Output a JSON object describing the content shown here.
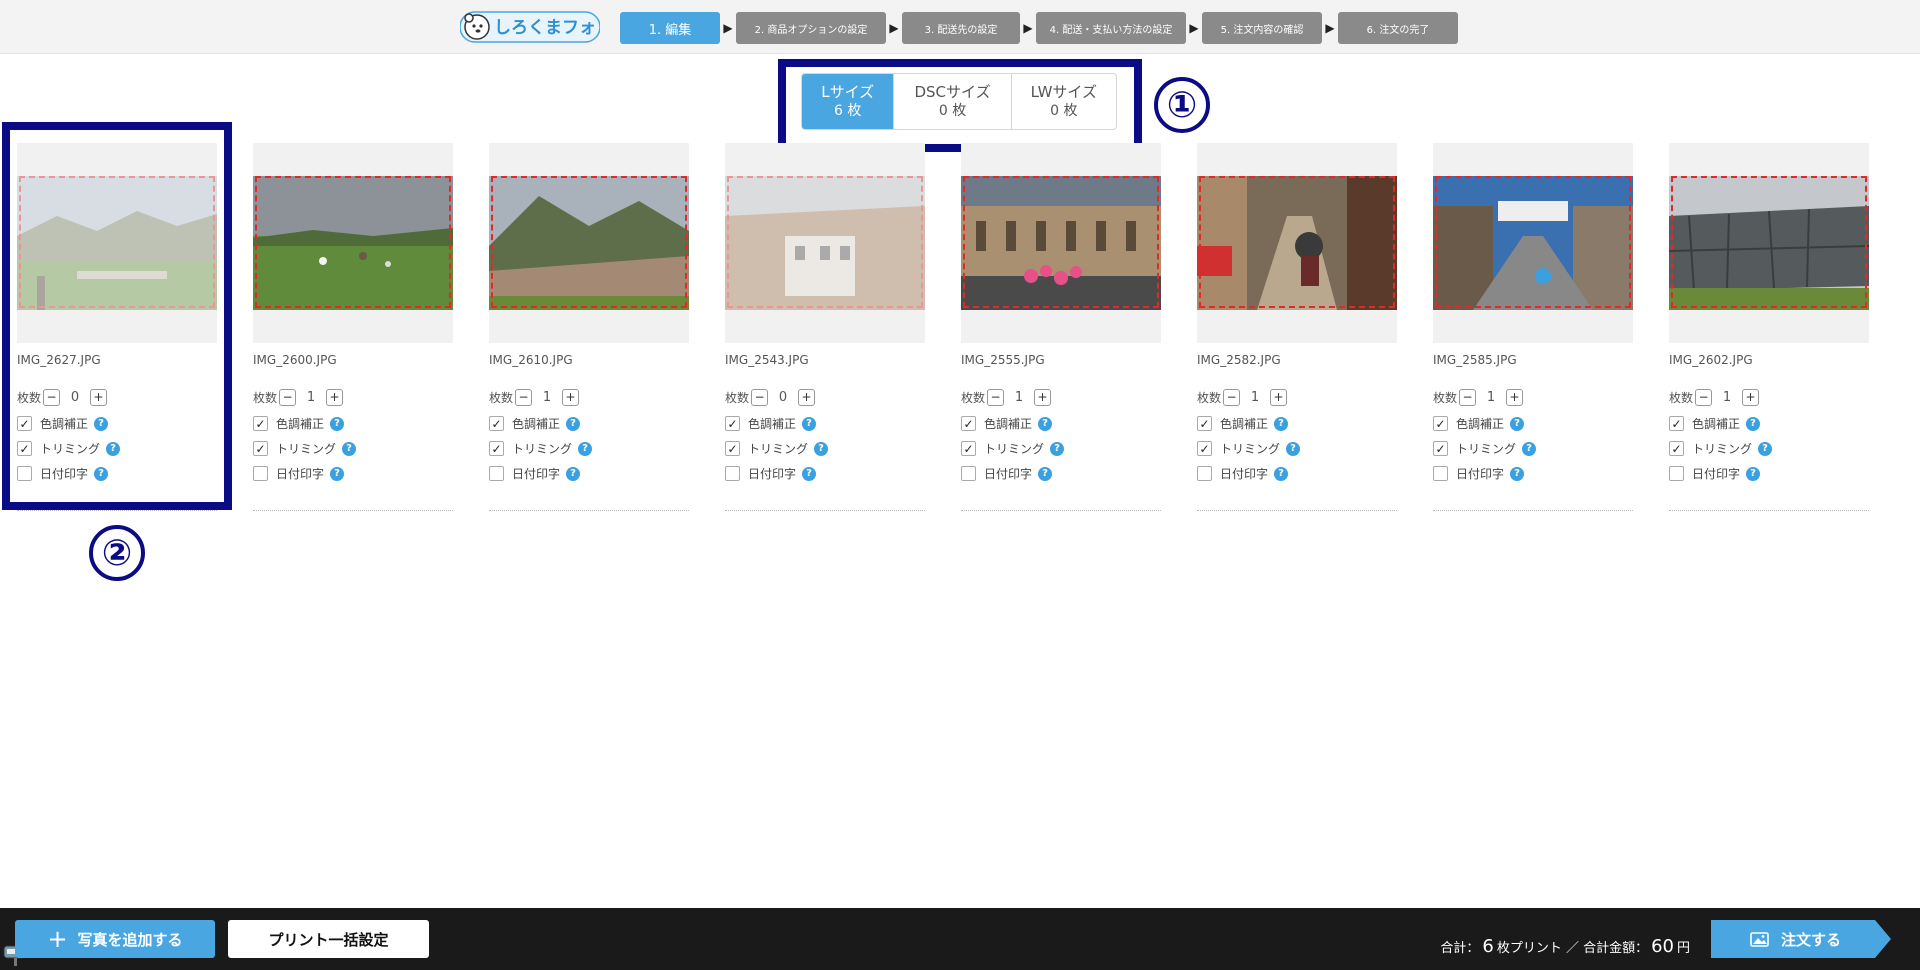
{
  "header": {
    "logo_text": "しろくまフォト",
    "steps": [
      {
        "label": "1. 編集",
        "active": true
      },
      {
        "label": "2. 商品オプションの設定",
        "active": false
      },
      {
        "label": "3. 配送先の設定",
        "active": false
      },
      {
        "label": "4. 配送・支払い方法の設定",
        "active": false
      },
      {
        "label": "5. 注文内容の確認",
        "active": false
      },
      {
        "label": "6. 注文の完了",
        "active": false
      }
    ]
  },
  "size_tabs": [
    {
      "name": "Lサイズ",
      "count": "6 枚",
      "active": true
    },
    {
      "name": "DSCサイズ",
      "count": "0 枚",
      "active": false
    },
    {
      "name": "LWサイズ",
      "count": "0 枚",
      "active": false
    }
  ],
  "annotations": {
    "one": "①",
    "two": "②"
  },
  "labels": {
    "qty": "枚数",
    "color": "色調補正",
    "trim": "トリミング",
    "date": "日付印字",
    "help": "?",
    "minus": "−",
    "plus": "+"
  },
  "photos": [
    {
      "filename": "IMG_2627.JPG",
      "qty": "0",
      "color": true,
      "trim": true,
      "date": false,
      "faded": true,
      "scene": "garden"
    },
    {
      "filename": "IMG_2600.JPG",
      "qty": "1",
      "color": true,
      "trim": true,
      "date": false,
      "faded": false,
      "scene": "meadow"
    },
    {
      "filename": "IMG_2610.JPG",
      "qty": "1",
      "color": true,
      "trim": true,
      "date": false,
      "faded": false,
      "scene": "city-hill"
    },
    {
      "filename": "IMG_2543.JPG",
      "qty": "0",
      "color": true,
      "trim": true,
      "date": false,
      "faded": true,
      "scene": "rooftops"
    },
    {
      "filename": "IMG_2555.JPG",
      "qty": "1",
      "color": true,
      "trim": true,
      "date": false,
      "faded": false,
      "scene": "courtyard"
    },
    {
      "filename": "IMG_2582.JPG",
      "qty": "1",
      "color": true,
      "trim": true,
      "date": false,
      "faded": false,
      "scene": "street"
    },
    {
      "filename": "IMG_2585.JPG",
      "qty": "1",
      "color": true,
      "trim": true,
      "date": false,
      "faded": false,
      "scene": "avenue"
    },
    {
      "filename": "IMG_2602.JPG",
      "qty": "1",
      "color": true,
      "trim": true,
      "date": false,
      "faded": false,
      "scene": "stone-wall"
    }
  ],
  "footer": {
    "add_photo": "写真を追加する",
    "bulk_print": "プリント一括設定",
    "total_prefix": "合計：",
    "total_count": "6",
    "total_mid": "枚プリント ／ 合計金額：",
    "total_amount": "60",
    "total_unit": "円",
    "order": "注文する"
  },
  "colors": {
    "accent": "#4aa6e0",
    "annotation": "#0b0b86",
    "step_inactive": "#8a8a8a",
    "footer_bg": "#1a1a1a",
    "crop_line": "#e02a2a"
  }
}
